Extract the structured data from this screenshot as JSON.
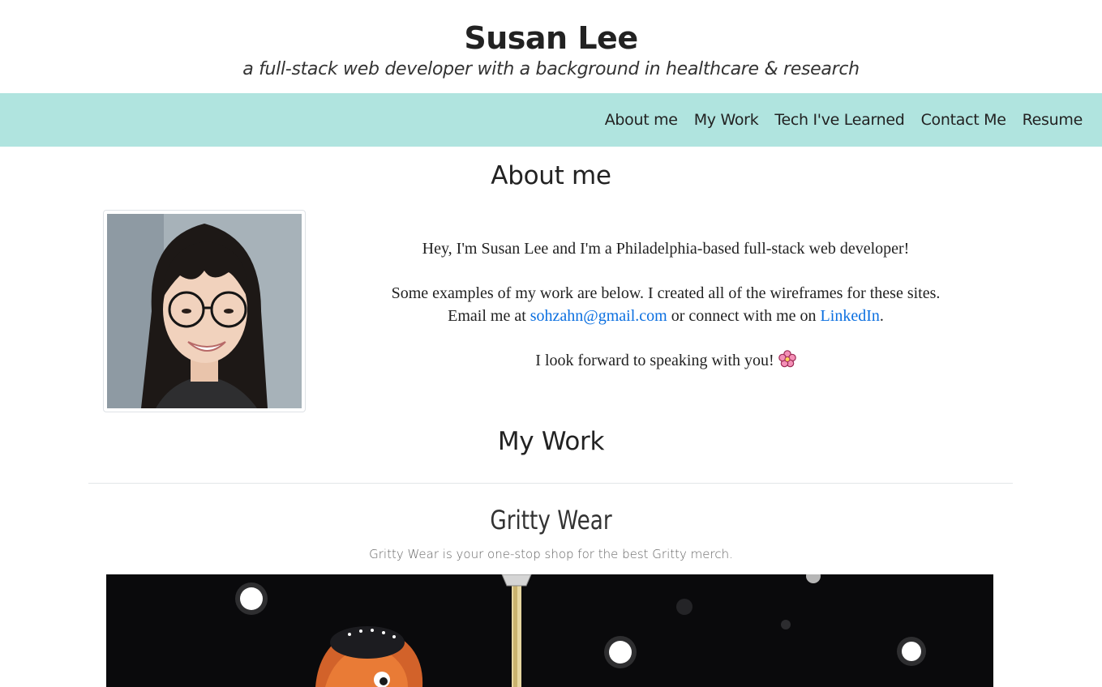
{
  "header": {
    "name": "Susan Lee",
    "tagline": "a full-stack web developer with a background in healthcare & research"
  },
  "nav": {
    "items": [
      "About me",
      "My Work",
      "Tech I've Learned",
      "Contact Me",
      "Resume"
    ]
  },
  "about": {
    "heading": "About me",
    "intro": "Hey, I'm Susan Lee and I'm a Philadelphia-based full-stack web developer!",
    "examples": "Some examples of my work are below. I created all of the wireframes for these sites.",
    "email_prefix": "Email me at ",
    "email": "sohzahn@gmail.com",
    "connect_text": " or connect with me on ",
    "linkedin": "LinkedIn",
    "period": ".",
    "closing": "I look forward to speaking with you! "
  },
  "work": {
    "heading": "My Work",
    "projects": [
      {
        "title": "Gritty Wear",
        "description": "Gritty Wear is your one-stop shop for the best Gritty merch."
      }
    ]
  },
  "colors": {
    "navbar_bg": "#b0e4df",
    "link": "#0b6fe0"
  }
}
